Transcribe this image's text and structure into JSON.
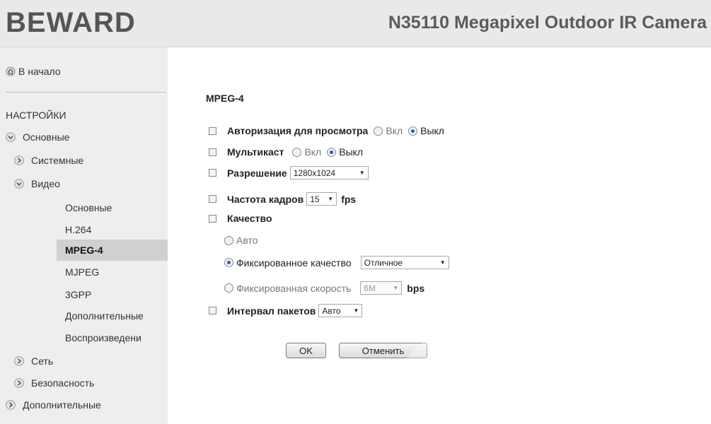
{
  "header": {
    "logo": "BEWARD",
    "title": "N35110 Megapixel Outdoor IR Camera"
  },
  "sidebar": {
    "home": "В начало",
    "section": "НАСТРОЙКИ",
    "items": {
      "basic": "Основные",
      "system": "Системные",
      "video": "Видео",
      "video_sub": [
        "Основные",
        "H.264",
        "MPEG-4",
        "MJPEG",
        "3GPP",
        "Дополнительные",
        "Воспроизведени"
      ],
      "network": "Сеть",
      "security": "Безопасность",
      "extra": "Дополнительные"
    }
  },
  "main": {
    "heading": "MPEG-4",
    "auth": {
      "label": "Авторизация для просмотра",
      "on": "Вкл",
      "off": "Выкл",
      "selected": "off"
    },
    "multicast": {
      "label": "Мультикаст",
      "on": "Вкл",
      "off": "Выкл",
      "selected": "off"
    },
    "resolution": {
      "label": "Разрешение",
      "value": "1280x1024"
    },
    "framerate": {
      "label": "Частота кадров",
      "value": "15",
      "unit": "fps"
    },
    "quality": {
      "label": "Качество",
      "auto": "Авто",
      "fixed_quality": "Фиксированное качество",
      "fixed_quality_value": "Отличное",
      "fixed_rate": "Фиксированная скорость",
      "fixed_rate_value": "6M",
      "fixed_rate_unit": "bps",
      "selected": "fixed_quality"
    },
    "packet": {
      "label": "Интервал пакетов",
      "value": "Авто"
    },
    "ok": "OK",
    "cancel": "Отменить"
  },
  "colors": {
    "sidebar_bg": "#eeeeee",
    "header_bg": "#e9e9e9",
    "active_bg": "#d0d0d0",
    "radio_on": "#2a5db0"
  }
}
